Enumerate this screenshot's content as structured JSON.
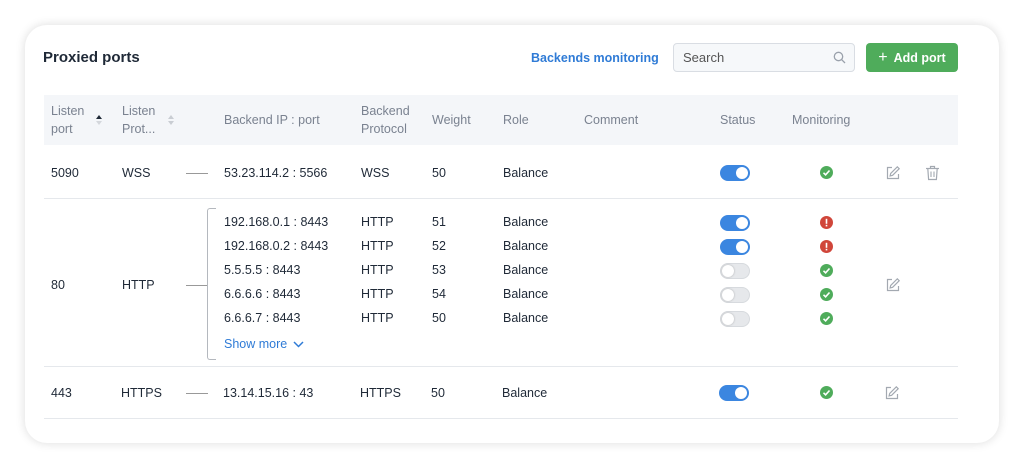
{
  "header": {
    "title": "Proxied ports",
    "monitoring_link": "Backends monitoring",
    "search_placeholder": "Search",
    "add_button": "Add port"
  },
  "columns": {
    "listen_port": [
      "Listen",
      "port"
    ],
    "listen_protocol": [
      "Listen",
      "Prot..."
    ],
    "backend_ip": "Backend IP : port",
    "backend_protocol": [
      "Backend",
      "Protocol"
    ],
    "weight": "Weight",
    "role": "Role",
    "comment": "Comment",
    "status": "Status",
    "monitoring": "Monitoring"
  },
  "sort": {
    "column": "listen_port",
    "direction": "asc"
  },
  "rows": [
    {
      "listen_port": "5090",
      "listen_protocol": "WSS",
      "backends": [
        {
          "ip": "53.23.114.2 : 5566",
          "protocol": "WSS",
          "weight": "50",
          "role": "Balance",
          "enabled": true,
          "monitoring": "ok"
        }
      ],
      "deletable": true
    },
    {
      "listen_port": "80",
      "listen_protocol": "HTTP",
      "backends": [
        {
          "ip": "192.168.0.1 : 8443",
          "protocol": "HTTP",
          "weight": "51",
          "role": "Balance",
          "enabled": true,
          "monitoring": "error"
        },
        {
          "ip": "192.168.0.2 : 8443",
          "protocol": "HTTP",
          "weight": "52",
          "role": "Balance",
          "enabled": true,
          "monitoring": "error"
        },
        {
          "ip": "5.5.5.5 : 8443",
          "protocol": "HTTP",
          "weight": "53",
          "role": "Balance",
          "enabled": false,
          "monitoring": "ok"
        },
        {
          "ip": "6.6.6.6 : 8443",
          "protocol": "HTTP",
          "weight": "54",
          "role": "Balance",
          "enabled": false,
          "monitoring": "ok"
        },
        {
          "ip": "6.6.6.7 : 8443",
          "protocol": "HTTP",
          "weight": "50",
          "role": "Balance",
          "enabled": false,
          "monitoring": "ok"
        }
      ],
      "show_more": "Show more",
      "deletable": false
    },
    {
      "listen_port": "443",
      "listen_protocol": "HTTPS",
      "backends": [
        {
          "ip": "13.14.15.16 : 43",
          "protocol": "HTTPS",
          "weight": "50",
          "role": "Balance",
          "enabled": true,
          "monitoring": "ok"
        }
      ],
      "deletable": false
    }
  ],
  "colors": {
    "accent": "#3b86e0",
    "success": "#4fac5b",
    "error": "#d0463a",
    "link": "#2f7bd6"
  }
}
